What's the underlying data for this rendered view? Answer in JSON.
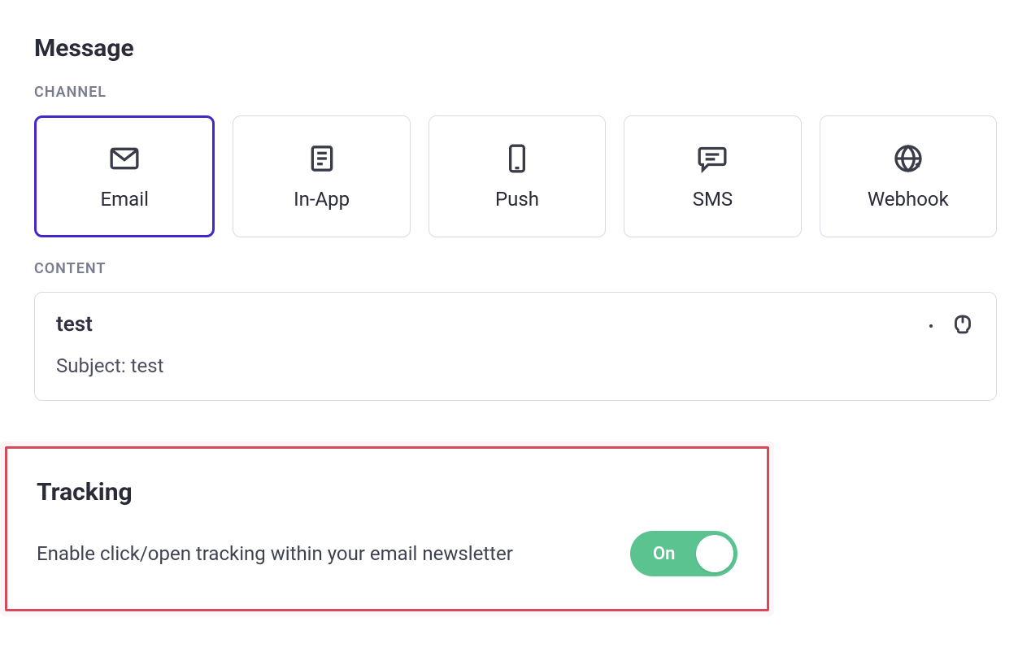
{
  "message": {
    "title": "Message",
    "channel_label": "CHANNEL",
    "content_label": "CONTENT",
    "channels": [
      {
        "label": "Email"
      },
      {
        "label": "In-App"
      },
      {
        "label": "Push"
      },
      {
        "label": "SMS"
      },
      {
        "label": "Webhook"
      }
    ],
    "content": {
      "name": "test",
      "subject_prefix": "Subject: ",
      "subject_value": "test"
    }
  },
  "tracking": {
    "title": "Tracking",
    "description": "Enable click/open tracking within your email newsletter",
    "toggle_label": "On",
    "toggle_on": true
  },
  "colors": {
    "accent": "#4527c9",
    "highlight": "#d44a5b",
    "toggle_on": "#5bc390"
  }
}
